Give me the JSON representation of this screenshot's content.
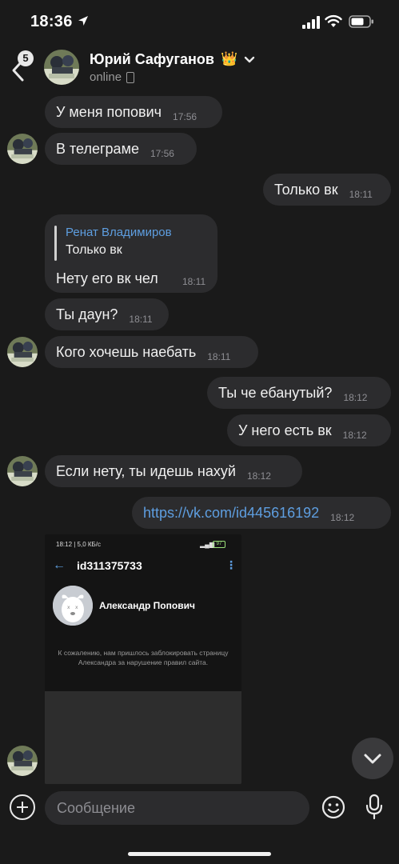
{
  "status_bar": {
    "time": "18:36"
  },
  "header": {
    "back_badge": "5",
    "name": "Юрий Сафуганов",
    "crown": "👑",
    "status": "online"
  },
  "messages": [
    {
      "text": "У меня попович",
      "time": "17:56",
      "dir": "in"
    },
    {
      "text": "В телеграме",
      "time": "17:56",
      "dir": "in"
    },
    {
      "text": "Только вк",
      "time": "18:11",
      "dir": "out"
    },
    {
      "reply_author": "Ренат Владимиров",
      "reply_text": "Только вк",
      "text": "Нету его вк чел",
      "time": "18:11",
      "dir": "in"
    },
    {
      "text": "Ты даун?",
      "time": "18:11",
      "dir": "in"
    },
    {
      "text": "Кого хочешь наебать",
      "time": "18:11",
      "dir": "in"
    },
    {
      "text": "Ты че ебанутый?",
      "time": "18:12",
      "dir": "out"
    },
    {
      "text": "У него есть вк",
      "time": "18:12",
      "dir": "out"
    },
    {
      "text": "Если нету, ты идешь нахуй",
      "time": "18:12",
      "dir": "in"
    },
    {
      "text": "https://vk.com/id445616192",
      "time": "18:12",
      "dir": "out"
    }
  ],
  "attachment": {
    "status_left": "18:12 | 5,0 КБ/с",
    "battery": "97",
    "title": "id311375733",
    "profile_name": "Александр Попович",
    "note": "К сожалению, нам пришлось заблокировать страницу Александра за нарушение правил сайта."
  },
  "input": {
    "placeholder": "Сообщение"
  },
  "colors": {
    "background": "#1a1a1a",
    "bubble": "#2c2c2e",
    "link": "#5e9ee0",
    "accent_battery": "#9be07a"
  }
}
